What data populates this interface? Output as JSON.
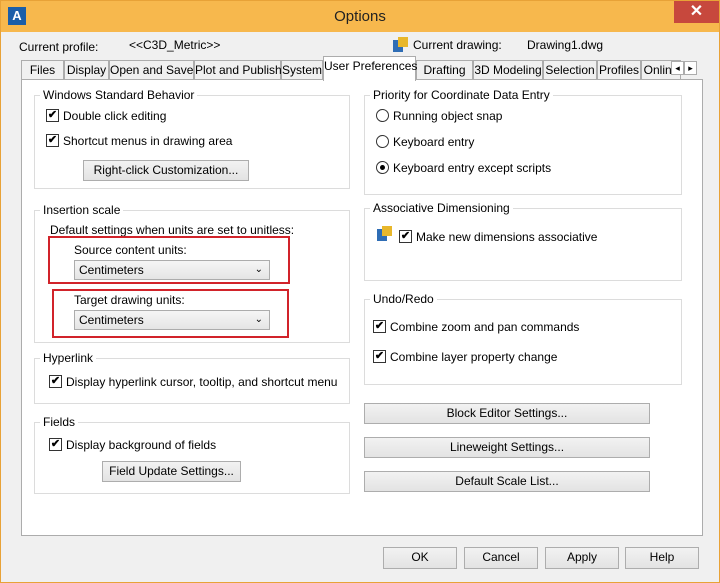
{
  "window": {
    "title": "Options",
    "close_glyph": "✕",
    "app_icon_letter": "A"
  },
  "profile": {
    "current_profile_label": "Current profile:",
    "current_profile_value": "<<C3D_Metric>>",
    "current_drawing_label": "Current drawing:",
    "current_drawing_value": "Drawing1.dwg"
  },
  "tabs": [
    "Files",
    "Display",
    "Open and Save",
    "Plot and Publish",
    "System",
    "User Preferences",
    "Drafting",
    "3D Modeling",
    "Selection",
    "Profiles",
    "Online"
  ],
  "active_tab": "User Preferences",
  "windows_behavior": {
    "title": "Windows Standard Behavior",
    "double_click": "Double click editing",
    "shortcut_menus": "Shortcut menus in drawing area",
    "rightclick_button": "Right-click Customization..."
  },
  "insertion_scale": {
    "title": "Insertion scale",
    "default_text": "Default settings when units are set to unitless:",
    "source_label": "Source content units:",
    "source_value": "Centimeters",
    "target_label": "Target drawing units:",
    "target_value": "Centimeters"
  },
  "hyperlink": {
    "title": "Hyperlink",
    "display_text": "Display hyperlink cursor, tooltip, and shortcut menu"
  },
  "fields": {
    "title": "Fields",
    "display_bg": "Display background of fields",
    "update_button": "Field Update Settings..."
  },
  "priority": {
    "title": "Priority for Coordinate Data Entry",
    "options": [
      "Running object snap",
      "Keyboard entry",
      "Keyboard entry except scripts"
    ],
    "selected_index": 2
  },
  "assoc_dim": {
    "title": "Associative Dimensioning",
    "make_assoc": "Make new dimensions associative"
  },
  "undo_redo": {
    "title": "Undo/Redo",
    "combine_zoom": "Combine zoom and pan commands",
    "combine_layer": "Combine layer property change"
  },
  "side_buttons": {
    "block_editor": "Block Editor Settings...",
    "lineweight": "Lineweight Settings...",
    "scale_list": "Default Scale List..."
  },
  "footer": {
    "ok": "OK",
    "cancel": "Cancel",
    "apply": "Apply",
    "help": "Help"
  },
  "checkbox_glyph": "✔",
  "scroll": {
    "left": "◂",
    "right": "▸"
  },
  "combo_arrow": "⌄",
  "highlight_color": "#d1232a"
}
